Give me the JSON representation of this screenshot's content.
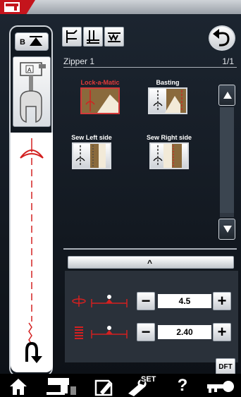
{
  "header": {
    "title": "Zipper 1",
    "page": "1/1"
  },
  "left_panel": {
    "button_b_label": "B"
  },
  "stitches": [
    {
      "label": "Lock-a-Matic",
      "selected": true
    },
    {
      "label": "Basting",
      "selected": false
    },
    {
      "label": "Sew Left side",
      "selected": false
    },
    {
      "label": "Sew Right side",
      "selected": false
    }
  ],
  "settings": {
    "width_value": "4.5",
    "length_value": "2.40",
    "minus": "−",
    "plus": "+",
    "caret": "^"
  },
  "dft_label": "DFT",
  "bottom": {
    "set_label": "SET",
    "help_label": "?"
  },
  "colors": {
    "accent_red": "#e53a3a",
    "panel": "#1c2530"
  }
}
